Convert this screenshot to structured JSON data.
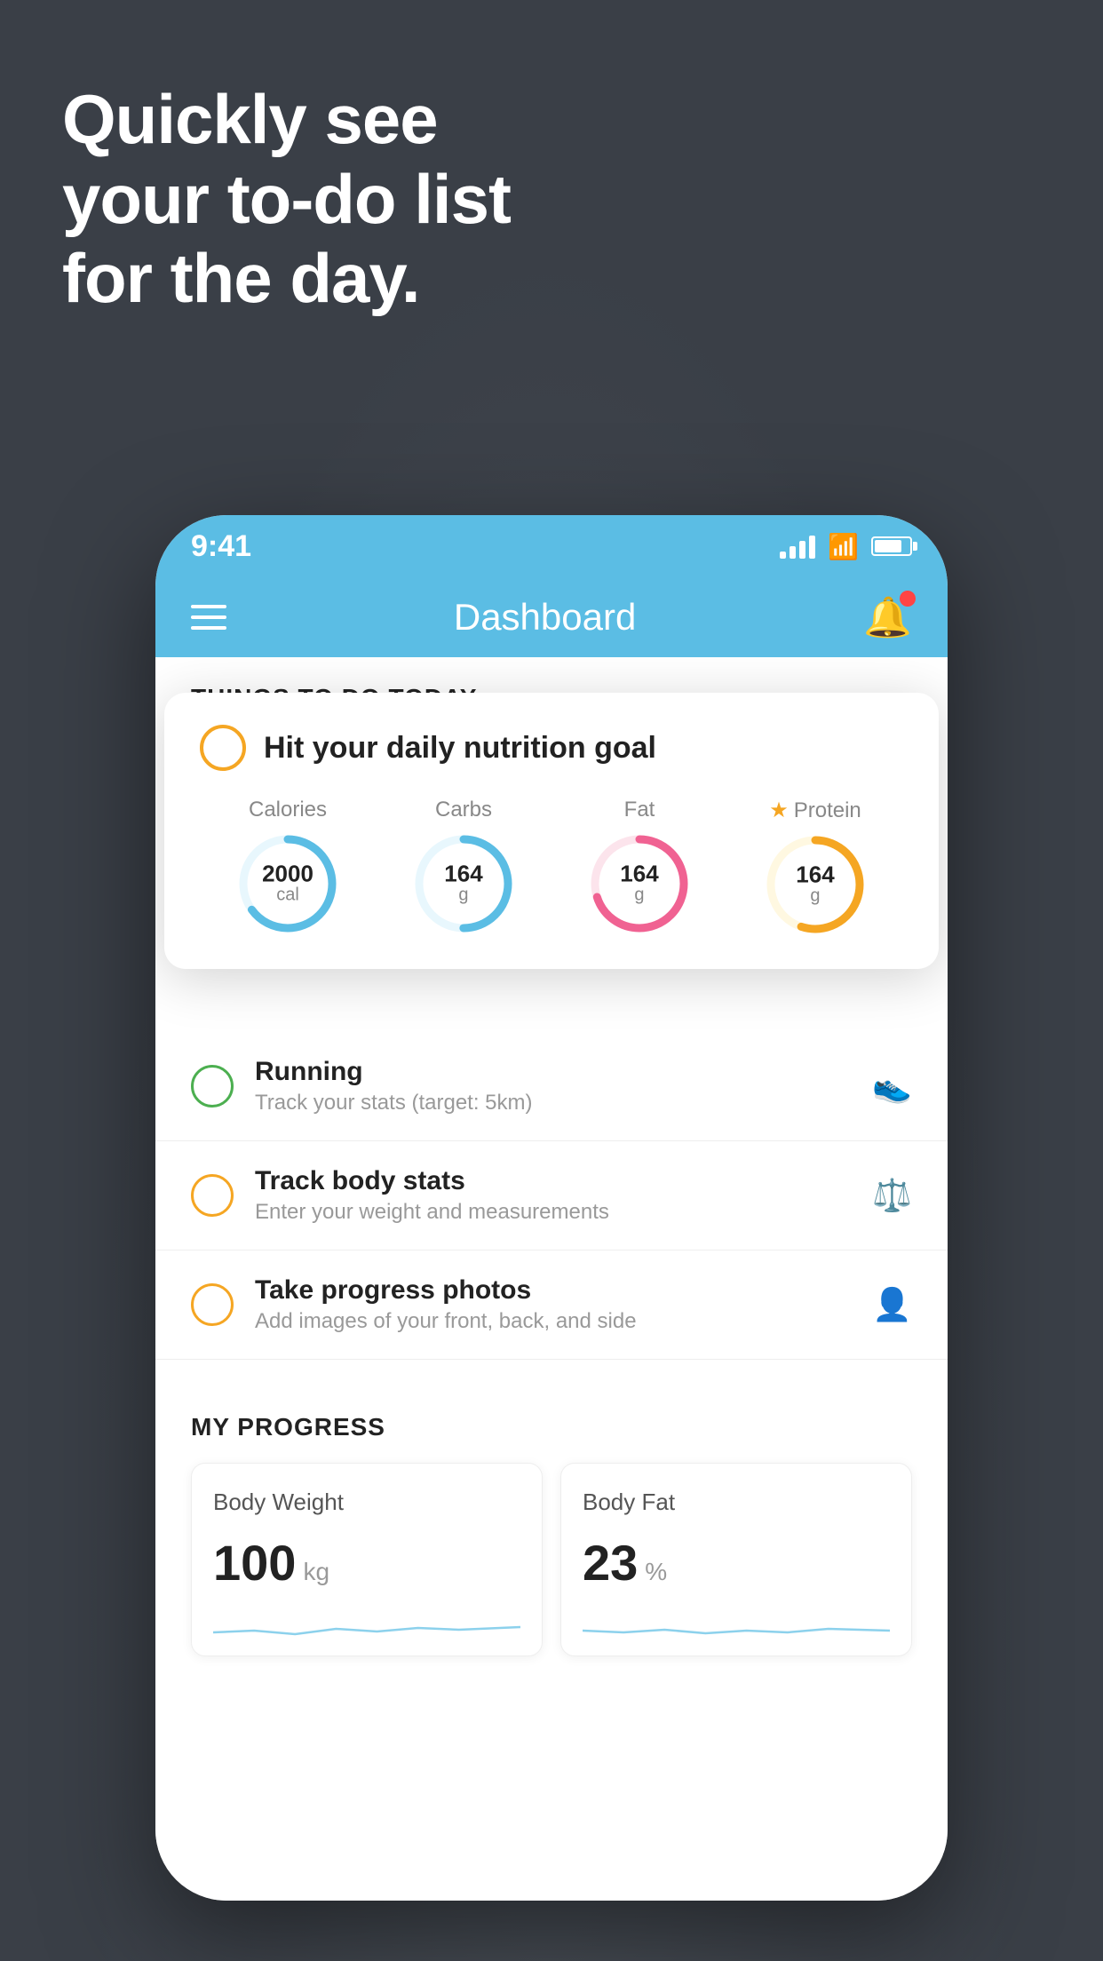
{
  "headline": {
    "line1": "Quickly see",
    "line2": "your to-do list",
    "line3": "for the day."
  },
  "status_bar": {
    "time": "9:41"
  },
  "header": {
    "title": "Dashboard"
  },
  "things_section": {
    "title": "THINGS TO DO TODAY"
  },
  "nutrition_card": {
    "check_label": "circle-check",
    "title": "Hit your daily nutrition goal",
    "nutrients": [
      {
        "label": "Calories",
        "value": "2000",
        "unit": "cal",
        "color": "#5bbde4",
        "bg": "#e8f7fd",
        "percent": 65,
        "star": false
      },
      {
        "label": "Carbs",
        "value": "164",
        "unit": "g",
        "color": "#5bbde4",
        "bg": "#e8f7fd",
        "percent": 50,
        "star": false
      },
      {
        "label": "Fat",
        "value": "164",
        "unit": "g",
        "color": "#f06292",
        "bg": "#fce4ec",
        "percent": 70,
        "star": false
      },
      {
        "label": "Protein",
        "value": "164",
        "unit": "g",
        "color": "#f5a623",
        "bg": "#fff8e1",
        "percent": 55,
        "star": true
      }
    ]
  },
  "todo_items": [
    {
      "id": "running",
      "title": "Running",
      "subtitle": "Track your stats (target: 5km)",
      "circle_color": "green",
      "icon": "👟"
    },
    {
      "id": "track-body",
      "title": "Track body stats",
      "subtitle": "Enter your weight and measurements",
      "circle_color": "yellow",
      "icon": "⚖️"
    },
    {
      "id": "progress-photos",
      "title": "Take progress photos",
      "subtitle": "Add images of your front, back, and side",
      "circle_color": "yellow",
      "icon": "👤"
    }
  ],
  "progress_section": {
    "title": "MY PROGRESS",
    "cards": [
      {
        "id": "body-weight",
        "title": "Body Weight",
        "value": "100",
        "unit": "kg"
      },
      {
        "id": "body-fat",
        "title": "Body Fat",
        "value": "23",
        "unit": "%"
      }
    ]
  }
}
